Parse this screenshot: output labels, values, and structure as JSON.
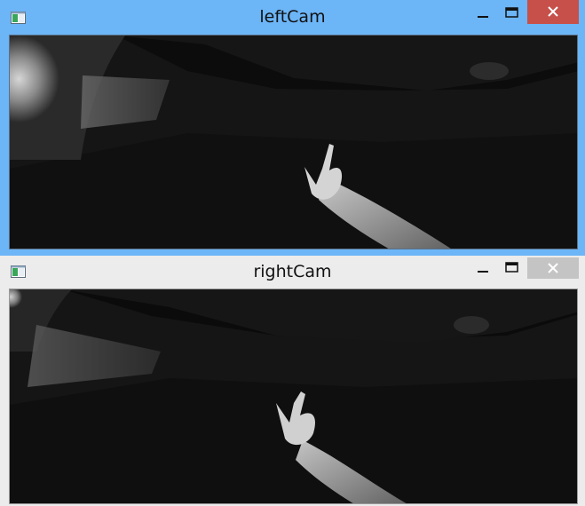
{
  "windows": {
    "left": {
      "title": "leftCam",
      "controls": {
        "minimize_icon": "minimize-icon",
        "maximize_icon": "maximize-icon",
        "close_icon": "close-icon"
      },
      "accent": "#6cb5f7",
      "close_color": "#c7504a"
    },
    "right": {
      "title": "rightCam",
      "controls": {
        "minimize_icon": "minimize-icon",
        "maximize_icon": "maximize-icon",
        "close_icon": "close-icon"
      },
      "accent": "#ececec",
      "close_color": "#c4c4c4"
    }
  }
}
